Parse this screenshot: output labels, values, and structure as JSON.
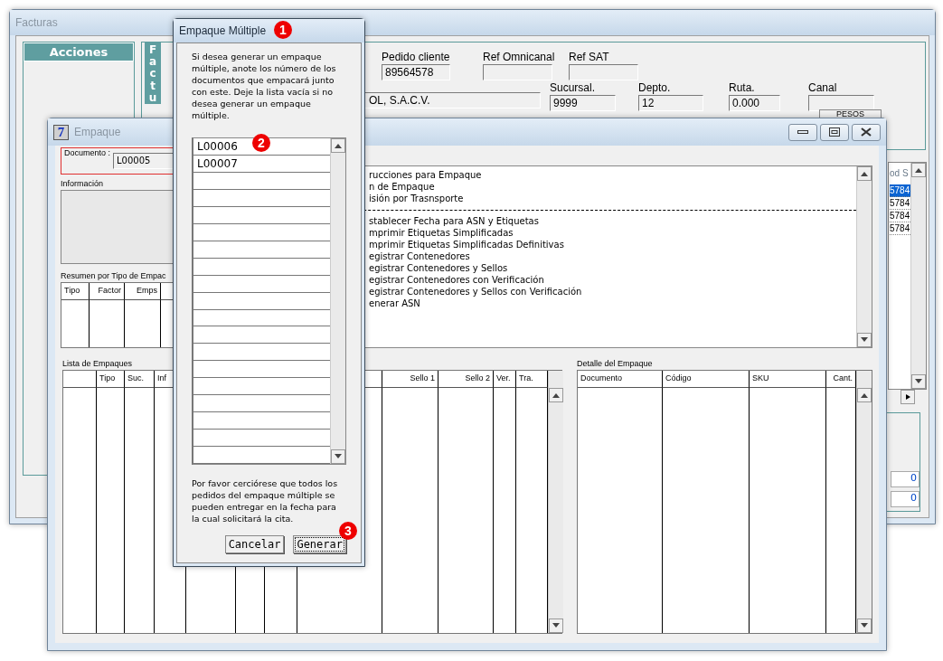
{
  "facturas": {
    "title": "Facturas",
    "actions_title": "Acciones",
    "vertical_tab": [
      "F",
      "a",
      "c",
      "t",
      "u"
    ],
    "fields": [
      {
        "label": "Pedido cliente",
        "value": "89564578"
      },
      {
        "label": "Ref Omnicanal"
      },
      {
        "label": "Ref SAT"
      },
      {
        "value": "OL, S.A.C.V."
      },
      {
        "label": "Sucursal.",
        "value": "9999"
      },
      {
        "label": "Depto.",
        "value": "12"
      },
      {
        "label": "Ruta.",
        "value": "0.000"
      },
      {
        "label": "Canal"
      }
    ],
    "currency_button": "PESOS",
    "code_list": {
      "header": "od S",
      "rows": [
        {
          "text": "5784",
          "selected": true
        },
        {
          "text": "5784",
          "selected": false
        },
        {
          "text": "5784",
          "selected": false
        },
        {
          "text": "5784",
          "selected": false
        }
      ]
    },
    "totals": [
      "0",
      "0"
    ]
  },
  "empaque": {
    "title": "Empaque",
    "app_icon": "7",
    "document_label": "Documento :",
    "document_value": "L00005",
    "info_label": "Información",
    "summary_label": "Resumen por Tipo de Empac",
    "summary_columns": [
      "Tipo",
      "Factor",
      "Emps"
    ],
    "menu": [
      {
        "kind": "item",
        "text": "rucciones para Empaque"
      },
      {
        "kind": "item",
        "text": "n de Empaque"
      },
      {
        "kind": "item",
        "text": "isión por Trasnsporte"
      },
      {
        "kind": "separator"
      },
      {
        "kind": "item",
        "text": "stablecer Fecha para ASN y Etiquetas"
      },
      {
        "kind": "item",
        "text": "mprimir Etiquetas Simplificadas"
      },
      {
        "kind": "item",
        "text": "mprimir Etiquetas Simplificadas Definitivas"
      },
      {
        "kind": "item",
        "text": "egistrar Contenedores"
      },
      {
        "kind": "item",
        "text": "egistrar Contenedores y Sellos"
      },
      {
        "kind": "item",
        "text": "egistrar Contenedores con Verificación"
      },
      {
        "kind": "item",
        "text": "egistrar Contenedores y Sellos con Verificación"
      },
      {
        "kind": "item",
        "text": "enerar ASN"
      }
    ],
    "packages_label": "Lista de Empaques",
    "packages_columns": [
      {},
      {
        "label": "Tipo"
      },
      {
        "label": "Suc."
      },
      {
        "label": "Inf"
      },
      {},
      {},
      {},
      {},
      {
        "label": "Sello 1"
      },
      {
        "label": "Sello 2"
      },
      {
        "label": "Ver."
      },
      {
        "label": "Tra."
      }
    ],
    "detail_label": "Detalle del Empaque",
    "detail_columns": [
      {
        "label": "Documento"
      },
      {
        "label": "Código"
      },
      {
        "label": "SKU"
      },
      {
        "label": "Cant."
      }
    ]
  },
  "dialog": {
    "title": "Empaque Múltiple",
    "intro": "Si desea generar un empaque múltiple, anote los número de los documentos que empacará junto con este. Deje la lista vacía si no desea generar un empaque múltiple.",
    "documents": [
      "L00006",
      "L00007"
    ],
    "note": "Por favor cerciórese que todos los pedidos del empaque múltiple se pueden entregar en la fecha para la cual solicitará la cita.",
    "buttons": [
      {
        "label": "Cancelar",
        "focused": false
      },
      {
        "label": "Generar",
        "focused": true
      }
    ]
  },
  "markers": [
    "1",
    "2",
    "3"
  ]
}
